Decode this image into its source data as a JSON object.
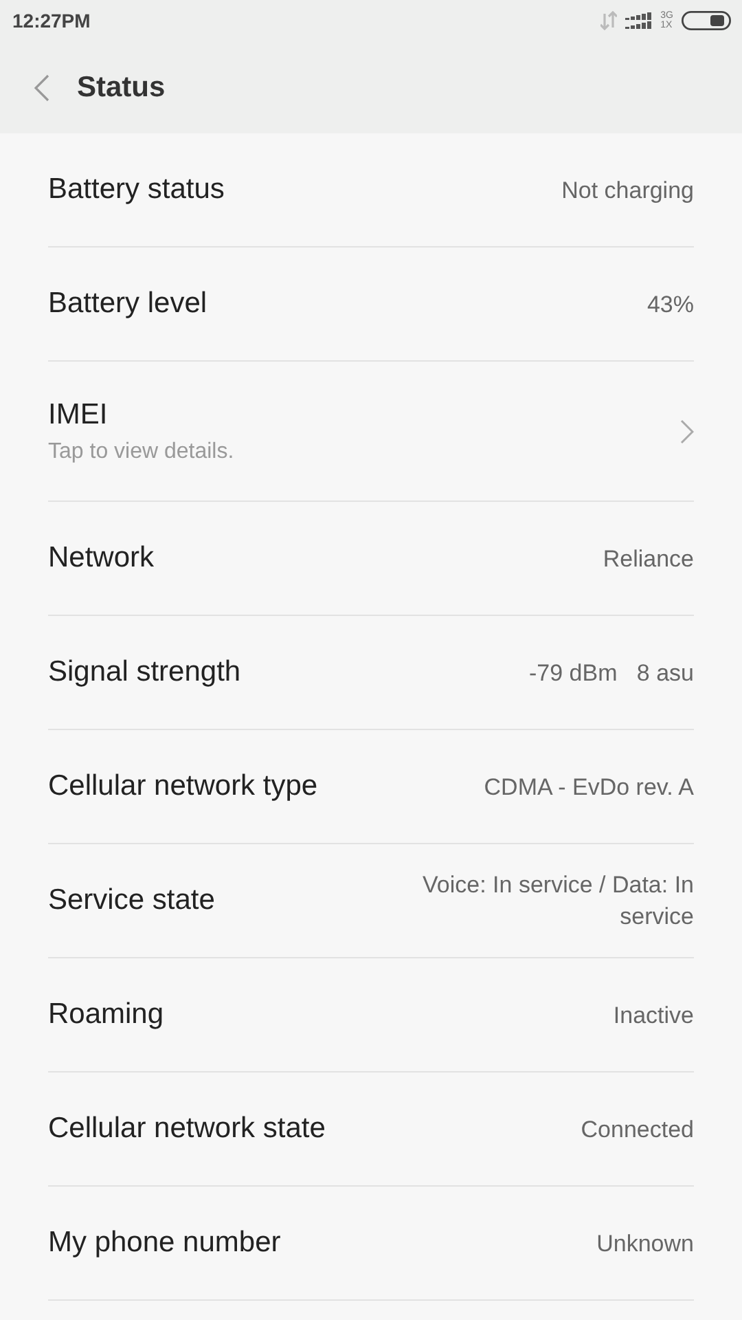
{
  "status_bar": {
    "time": "12:27PM",
    "network_labels": [
      "3G",
      "1X"
    ]
  },
  "header": {
    "title": "Status"
  },
  "rows": [
    {
      "kind": "value",
      "label": "Battery status",
      "value": "Not charging"
    },
    {
      "kind": "value",
      "label": "Battery level",
      "value": "43%"
    },
    {
      "kind": "link",
      "label": "IMEI",
      "subtitle": "Tap to view details."
    },
    {
      "kind": "value",
      "label": "Network",
      "value": "Reliance"
    },
    {
      "kind": "value",
      "label": "Signal strength",
      "value": "-79 dBm   8 asu"
    },
    {
      "kind": "value",
      "label": "Cellular network type",
      "value": "CDMA - EvDo rev. A"
    },
    {
      "kind": "value",
      "label": "Service state",
      "value": "Voice: In service / Data: In service"
    },
    {
      "kind": "value",
      "label": "Roaming",
      "value": "Inactive"
    },
    {
      "kind": "value",
      "label": "Cellular network state",
      "value": "Connected"
    },
    {
      "kind": "value",
      "label": "My phone number",
      "value": "Unknown"
    }
  ]
}
